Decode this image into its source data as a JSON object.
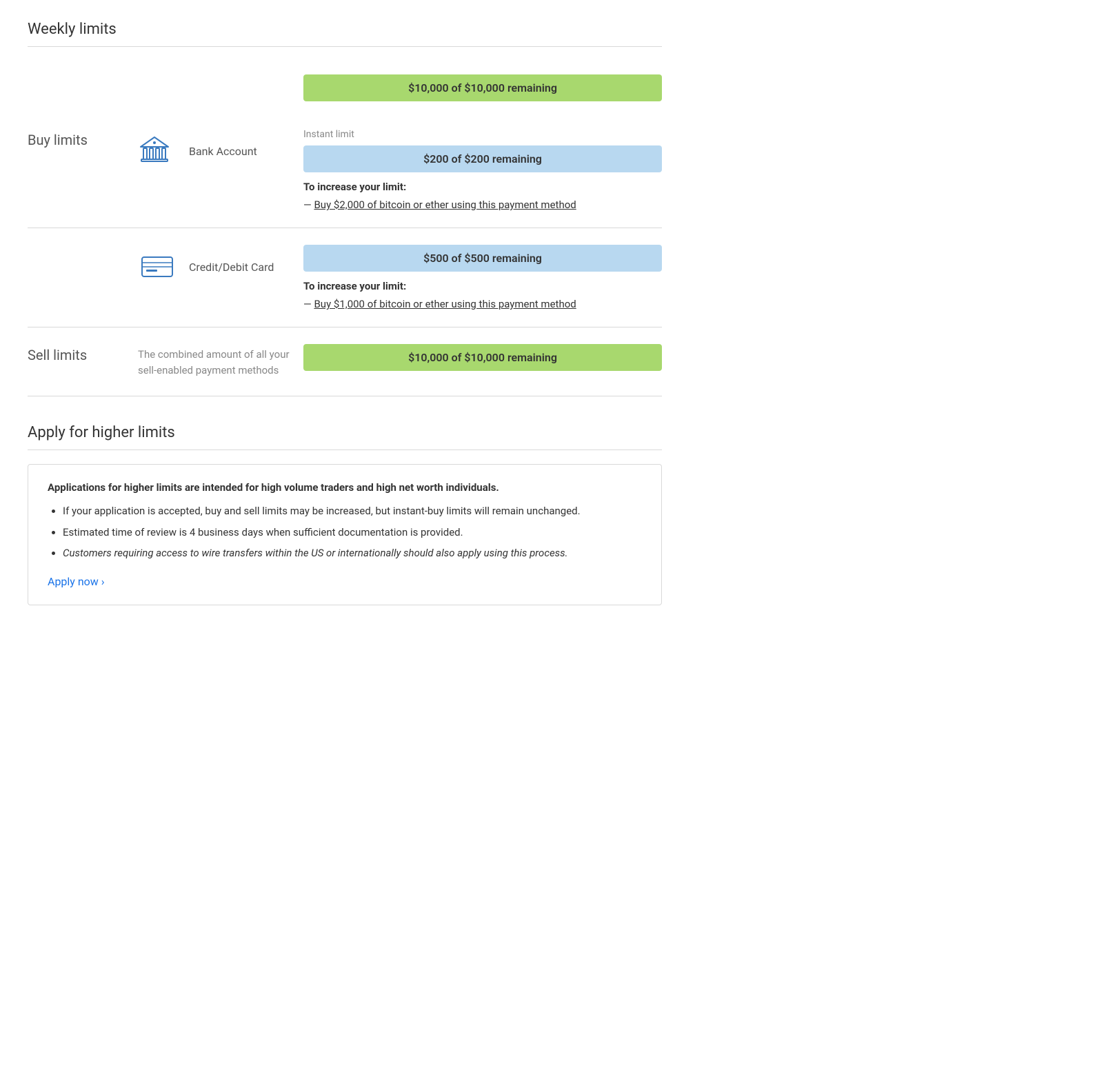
{
  "page": {
    "weekly_limits_title": "Weekly limits",
    "buy_limits_label": "Buy limits",
    "sell_limits_label": "Sell limits",
    "apply_section_title": "Apply for higher limits"
  },
  "buy_limits": {
    "overall_bar": {
      "text": "$10,000 of $10,000 remaining",
      "type": "green"
    },
    "methods": [
      {
        "name": "Bank Account",
        "icon": "bank",
        "instant_limit_label": "Instant limit",
        "bar_text": "$200 of $200 remaining",
        "bar_type": "blue",
        "increase_title": "To increase your limit:",
        "increase_link_text": "Buy $2,000 of bitcoin or ether using this payment method",
        "increase_prefix": "—"
      },
      {
        "name": "Credit/Debit Card",
        "icon": "card",
        "instant_limit_label": null,
        "bar_text": "$500 of $500 remaining",
        "bar_type": "blue",
        "increase_title": "To increase your limit:",
        "increase_link_text": "Buy $1,000 of bitcoin or ether using this payment method",
        "increase_prefix": "—"
      }
    ]
  },
  "sell_limits": {
    "description": "The combined amount of all your sell-enabled payment methods",
    "bar_text": "$10,000 of $10,000 remaining",
    "bar_type": "green"
  },
  "apply_section": {
    "info_title": "Applications for higher limits are intended for high volume traders and high net worth individuals.",
    "bullets": [
      {
        "text": "If your application is accepted, buy and sell limits may be increased, but instant-buy limits will remain unchanged.",
        "italic": false
      },
      {
        "text": "Estimated time of review is 4 business days when sufficient documentation is provided.",
        "italic": false
      },
      {
        "text": "Customers requiring access to wire transfers within the US or internationally should also apply using this process.",
        "italic": true
      }
    ],
    "apply_now_label": "Apply now ›"
  }
}
